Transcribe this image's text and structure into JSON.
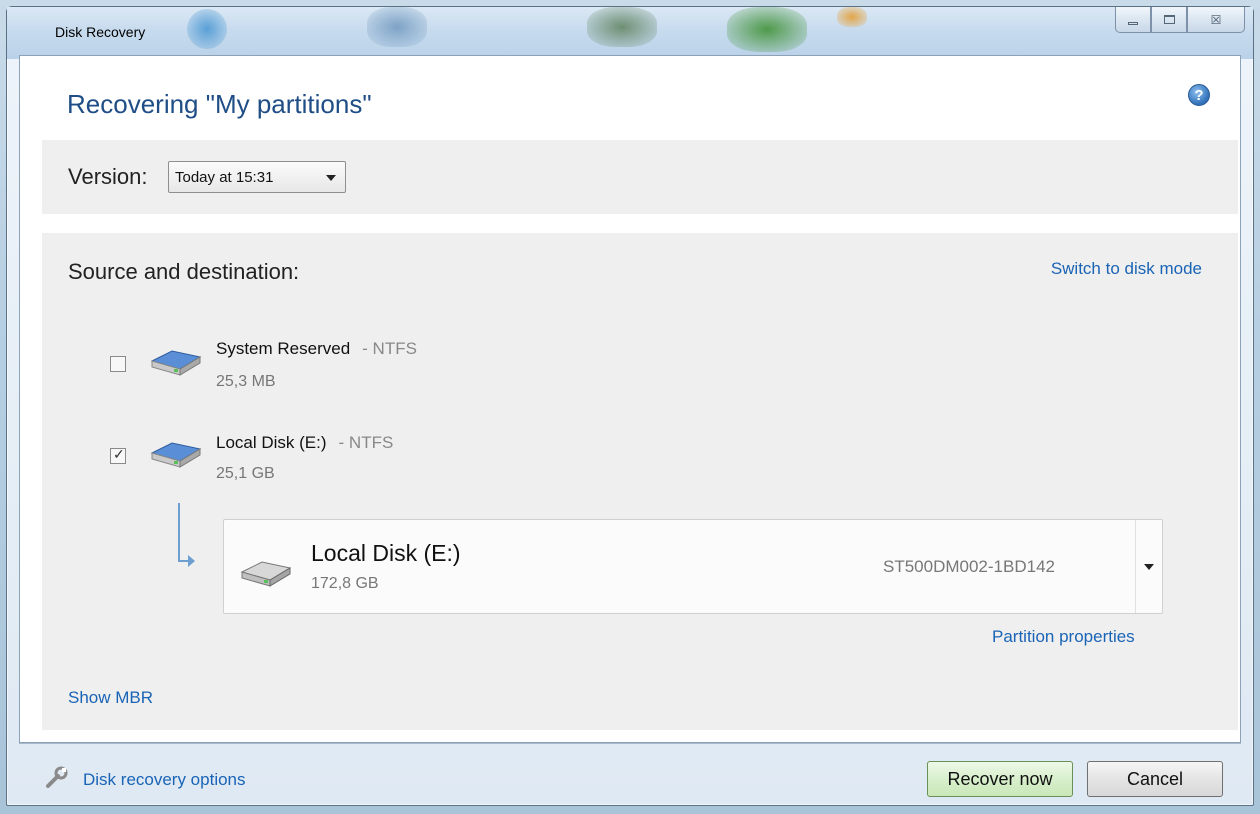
{
  "window": {
    "title": "Disk Recovery",
    "controls": [
      "minimize",
      "maximize",
      "close"
    ],
    "close_glyph": "☒"
  },
  "header": {
    "title": "Recovering \"My partitions\"",
    "help_glyph": "?"
  },
  "version": {
    "label": "Version:",
    "selected": "Today at 15:31"
  },
  "source": {
    "label": "Source and destination:",
    "switch_link": "Switch to disk mode",
    "partitions": [
      {
        "name": "System Reserved",
        "fs": "- NTFS",
        "size": "25,3 MB",
        "checked": false
      },
      {
        "name": "Local Disk (E:)",
        "fs": "- NTFS",
        "size": "25,1 GB",
        "checked": true
      }
    ],
    "destination": {
      "name": "Local Disk (E:)",
      "size": "172,8 GB",
      "model": "ST500DM002-1BD142"
    },
    "partition_properties_link": "Partition properties",
    "show_mbr_link": "Show MBR"
  },
  "footer": {
    "options_link": "Disk recovery options",
    "recover_button": "Recover now",
    "cancel_button": "Cancel"
  },
  "colors": {
    "link": "#1a64b6",
    "heading": "#1f4d85",
    "drive_blue": "#3f78c8"
  }
}
